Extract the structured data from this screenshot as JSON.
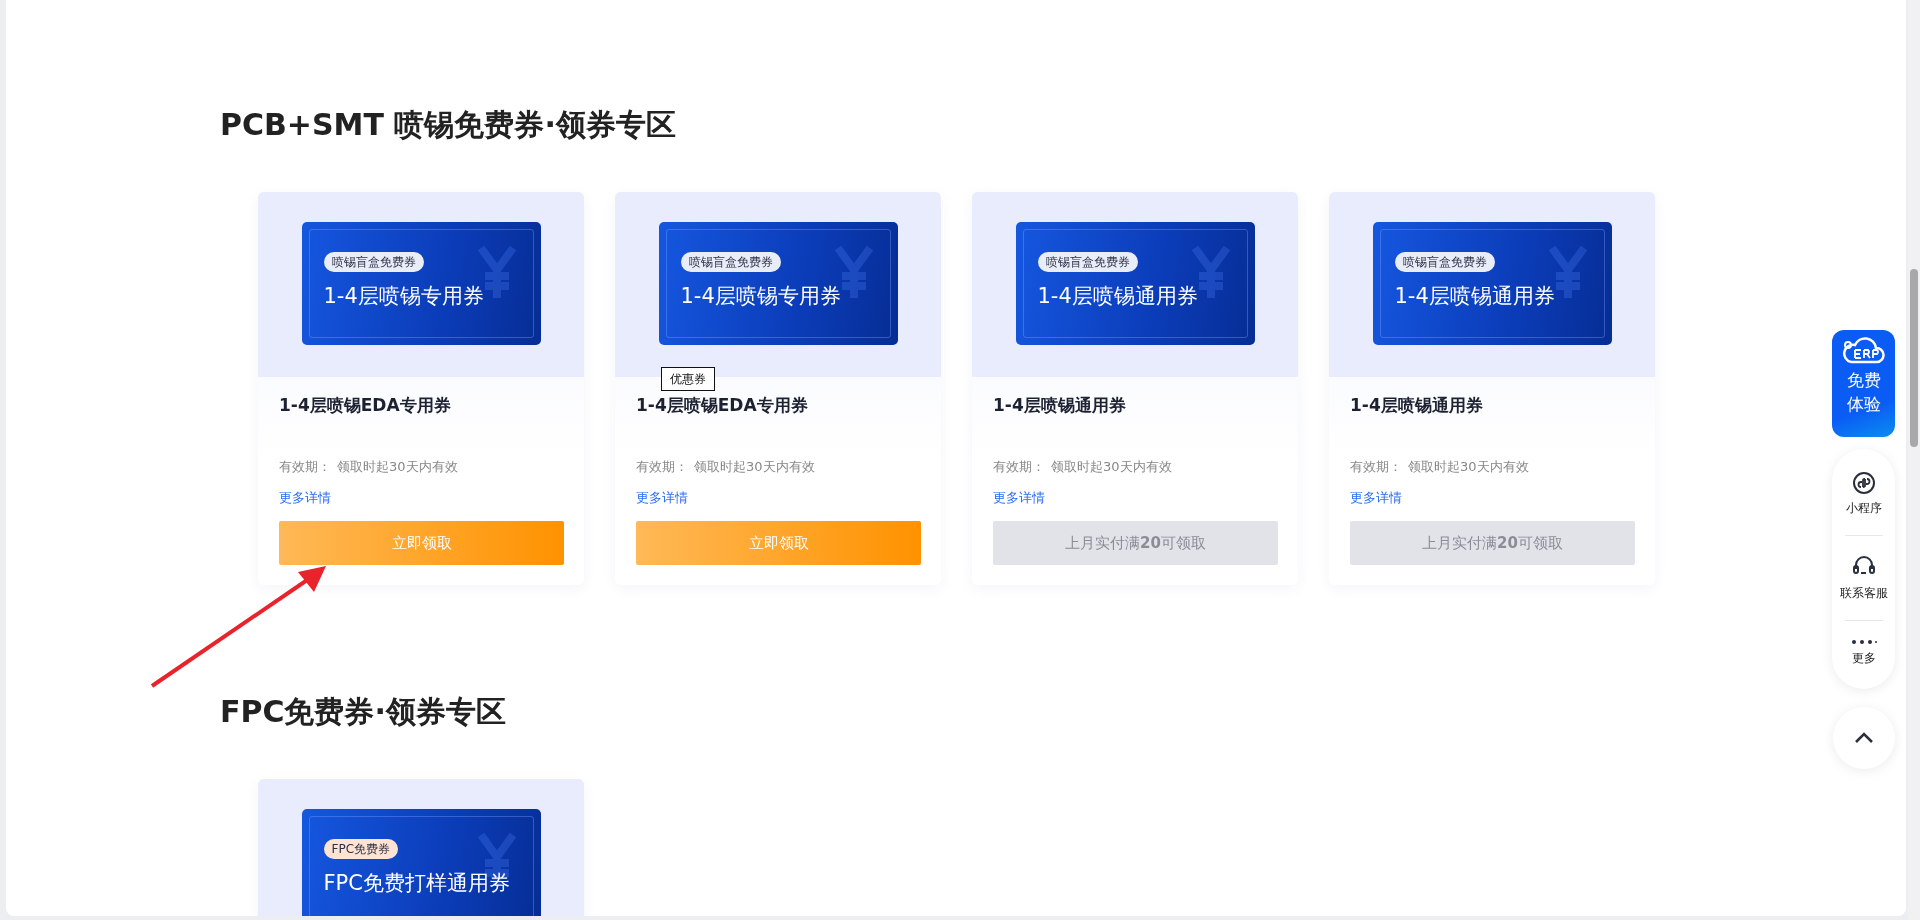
{
  "sections": [
    {
      "title": "PCB+SMT 喷锡免费券·领券专区",
      "cards": [
        {
          "ticket": {
            "tag": {
              "text": "喷锡盲盒免费券",
              "color": "#e9edf8"
            },
            "name": "1-4层喷锡专用券"
          },
          "title": "1-4层喷锡EDA专用券",
          "validity_label": "有效期：",
          "validity": "领取时起30天内有效",
          "details_link": "更多详情",
          "button": {
            "label": "立即领取",
            "disabled": false
          }
        },
        {
          "ticket": {
            "tag": {
              "text": "喷锡盲盒免费券",
              "color": "#e9edf8"
            },
            "name": "1-4层喷锡专用券"
          },
          "title": "1-4层喷锡EDA专用券",
          "validity_label": "有效期：",
          "validity": "领取时起30天内有效",
          "details_link": "更多详情",
          "button": {
            "label": "立即领取",
            "disabled": false
          }
        },
        {
          "ticket": {
            "tag": {
              "text": "喷锡盲盒免费券",
              "color": "#e9edf8"
            },
            "name": "1-4层喷锡通用券"
          },
          "title": "1-4层喷锡通用券",
          "validity_label": "有效期：",
          "validity": "领取时起30天内有效",
          "details_link": "更多详情",
          "button": {
            "label": "上月实付满**20**可领取",
            "disabled": true
          }
        },
        {
          "ticket": {
            "tag": {
              "text": "喷锡盲盒免费券",
              "color": "#e9edf8"
            },
            "name": "1-4层喷锡通用券"
          },
          "title": "1-4层喷锡通用券",
          "validity_label": "有效期：",
          "validity": "领取时起30天内有效",
          "details_link": "更多详情",
          "button": {
            "label": "上月实付满**20**可领取",
            "disabled": true
          }
        }
      ]
    },
    {
      "title": "FPC免费券·领券专区",
      "cards": [
        {
          "ticket": {
            "tag": {
              "text": "FPC免费券",
              "color": "#ffe4d3"
            },
            "name": "FPC免费打样通用券"
          }
        }
      ]
    }
  ],
  "tooltip": {
    "text": "优惠券"
  },
  "sidebar": {
    "promo": {
      "text": "免费体验"
    },
    "items": [
      {
        "label": "小程序",
        "kind": "miniprogram"
      },
      {
        "label": "联系客服",
        "kind": "service"
      },
      {
        "label": "更多",
        "kind": "more"
      }
    ]
  }
}
